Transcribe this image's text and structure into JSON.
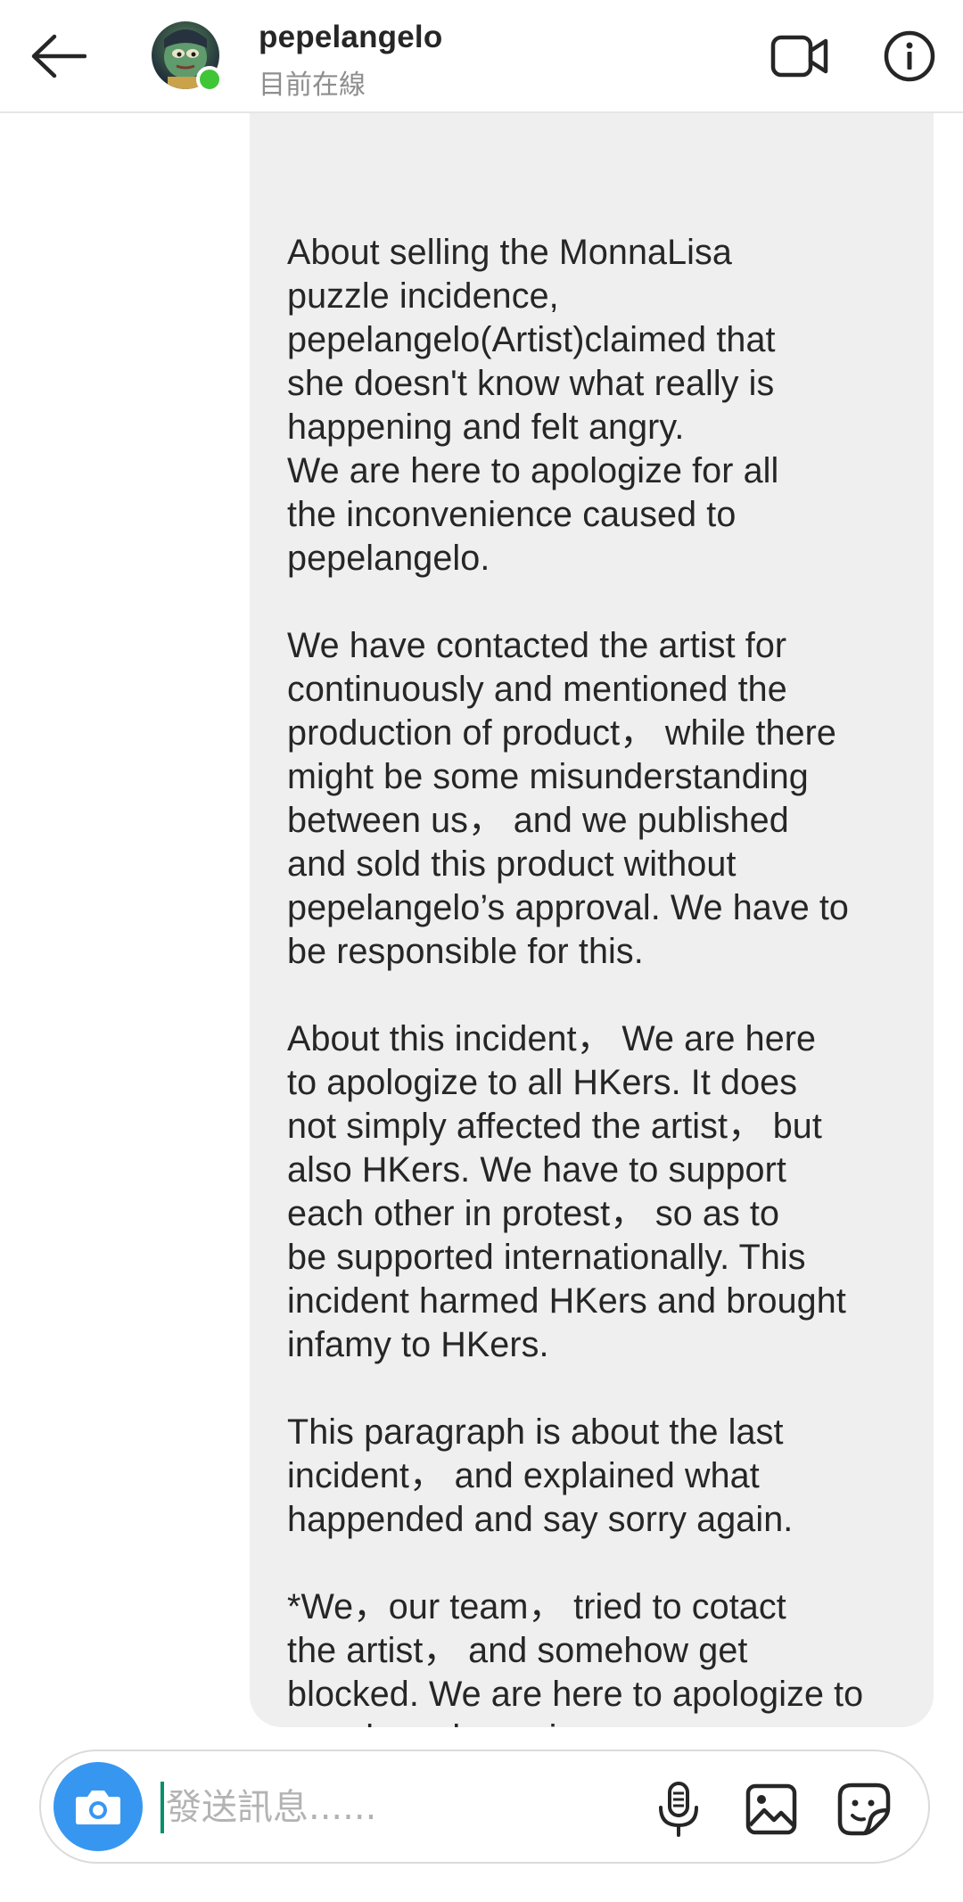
{
  "header": {
    "back_icon": "arrow-left-icon",
    "avatar_alt": "pepelangelo profile picture",
    "contact_name": "pepelangelo",
    "status": "目前在線",
    "video_icon": "video-camera-icon",
    "info_icon": "info-icon"
  },
  "conversation": {
    "message": {
      "paragraphs": [
        "About selling the MonnaLisa\npuzzle incidence,\npepelangelo(Artist)claimed that\nshe doesn't know what really is\nhappening and felt angry.\nWe are here to apologize for all\nthe inconvenience caused to\npepelangelo.",
        "We have contacted the artist for\ncontinuously and mentioned the\nproduction of product， while there\nmight be some misunderstanding\nbetween us， and we published\nand sold this product without\npepelangelo’s approval. We have to\nbe responsible for this.",
        "About this incident， We are here\nto apologize to all HKers. It does\nnot simply affected the artist， but\nalso HKers. We have to support\neach other in protest， so as to\nbe supported internationally. This\nincident harmed HKers and brought\ninfamy to HKers.",
        "This paragraph is about the last\nincident， and explained what\nhappended and say sorry again.",
        "*We，our team， tried to cotact\nthe artist， and somehow get\nblocked. We are here to apologize to\npepelangelo again."
      ]
    }
  },
  "composer": {
    "camera_icon": "camera-icon",
    "placeholder": "發送訊息......",
    "value": "",
    "mic_icon": "microphone-icon",
    "gallery_icon": "image-icon",
    "sticker_icon": "sticker-icon"
  },
  "colors": {
    "accent_blue": "#3797f0",
    "online_green": "#3ec637",
    "bubble_gray": "#efefef",
    "text": "#262626",
    "muted": "#8e8e8e"
  }
}
